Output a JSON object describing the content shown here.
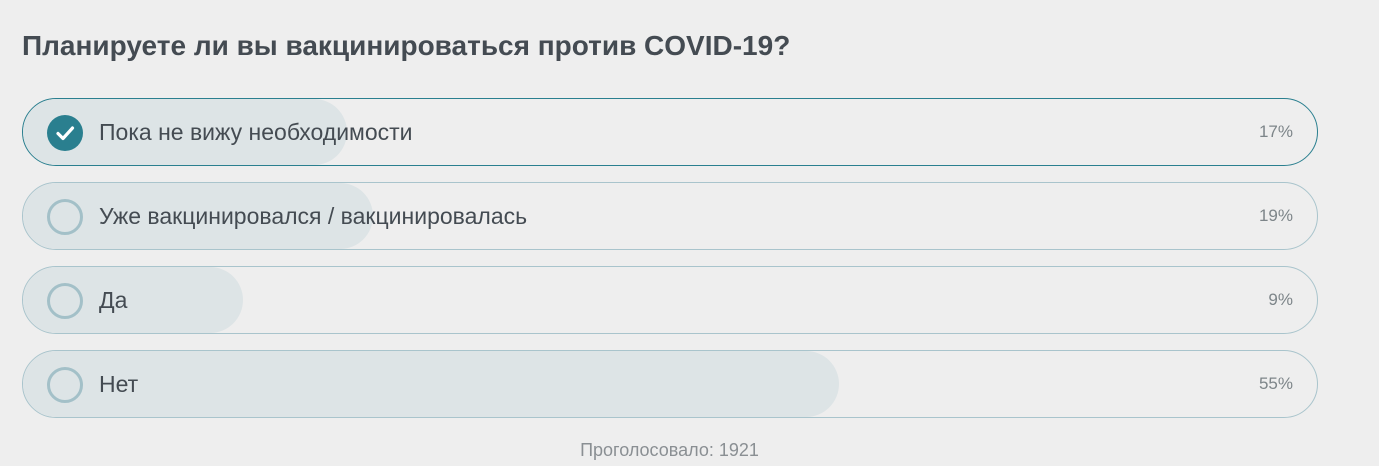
{
  "poll": {
    "question": "Планируете ли вы вакцинироваться против COVID-19?",
    "options": [
      {
        "label": "Пока не вижу необходимости",
        "percent": "17%",
        "share": 0.17,
        "selected": true
      },
      {
        "label": "Уже вакцинировался / вакцинировалась",
        "percent": "19%",
        "share": 0.19,
        "selected": false
      },
      {
        "label": "Да",
        "percent": "9%",
        "share": 0.09,
        "selected": false
      },
      {
        "label": "Нет",
        "percent": "55%",
        "share": 0.55,
        "selected": false
      }
    ],
    "votes_text": "Проголосовало: 1921"
  },
  "colors": {
    "accent": "#2a7f8f",
    "fill": "#dde4e6",
    "border": "#a9c4cc",
    "background": "#eeeeee"
  },
  "icons": {
    "selected": "checkmark-icon",
    "unselected": "radio-empty-icon"
  }
}
